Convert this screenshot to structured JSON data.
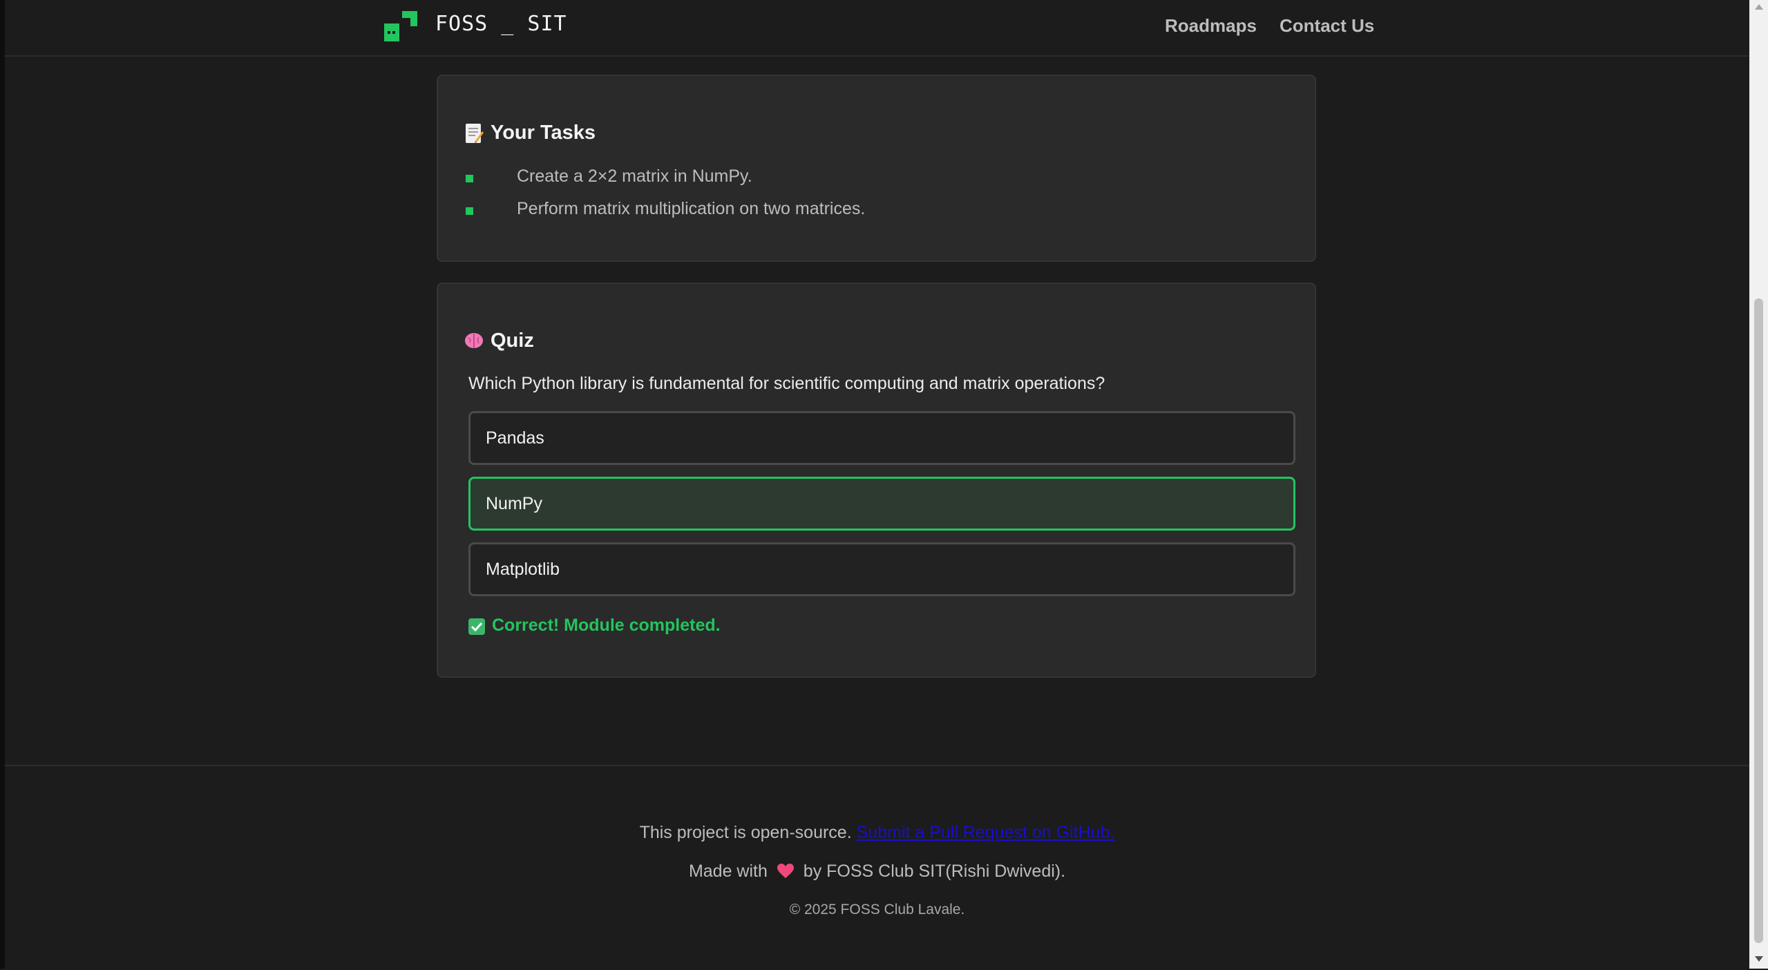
{
  "header": {
    "brand": "FOSS _ SIT",
    "nav": {
      "roadmaps": "Roadmaps",
      "contact": "Contact Us"
    }
  },
  "tasks": {
    "title": "Your Tasks",
    "icon": "memo-icon",
    "items": [
      "Create a 2×2 matrix in NumPy.",
      "Perform matrix multiplication on two matrices."
    ]
  },
  "quiz": {
    "title": "Quiz",
    "icon": "brain-icon",
    "question": "Which Python library is fundamental for scientific computing and matrix operations?",
    "options": [
      "Pandas",
      "NumPy",
      "Matplotlib"
    ],
    "selected": "NumPy",
    "result": "Correct! Module completed.",
    "result_icon": "check-box-icon"
  },
  "footer": {
    "line1_text": "This project is open-source.",
    "line1_link": "Submit a Pull Request on GitHub.",
    "line2_before": "Made with",
    "line2_after": "by FOSS Club SIT(Rishi Dwivedi).",
    "heart_icon": "heart-icon",
    "copyright": "© 2025 FOSS Club Lavale."
  },
  "colors": {
    "background": "#1c1c1c",
    "card": "#2a2a2a",
    "accent": "#22c55e",
    "link": "#1a0dcc"
  }
}
